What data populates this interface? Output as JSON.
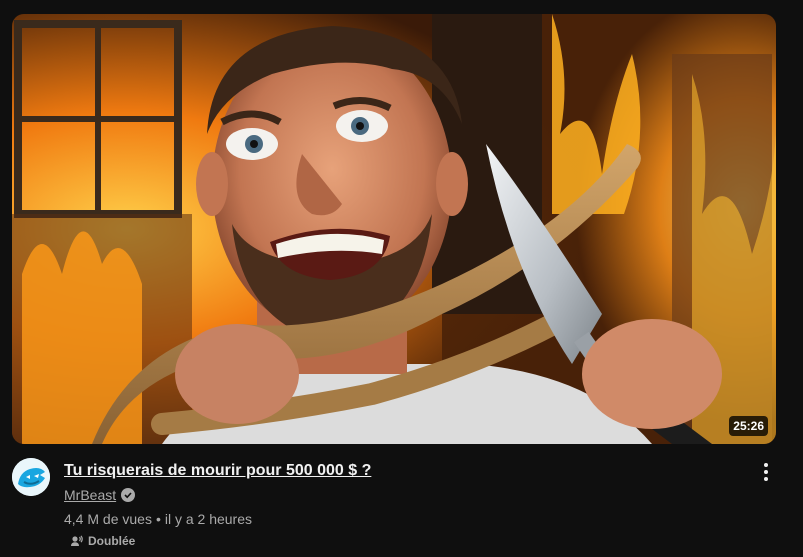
{
  "video": {
    "title": "Tu risquerais de mourir pour 500 000 $ ?",
    "duration": "25:26",
    "channel": "MrBeast",
    "views": "4,4 M de vues",
    "separator": "•",
    "age": "il y a 2 heures",
    "dubbed_label": "Doublée"
  },
  "icons": {
    "verified": "verified-check-icon",
    "menu": "more-vert-icon",
    "dubbed": "audio-dub-icon"
  },
  "colors": {
    "background": "#0f0f0f",
    "title": "#f1f1f1",
    "secondary_text": "#aaaaaa"
  }
}
